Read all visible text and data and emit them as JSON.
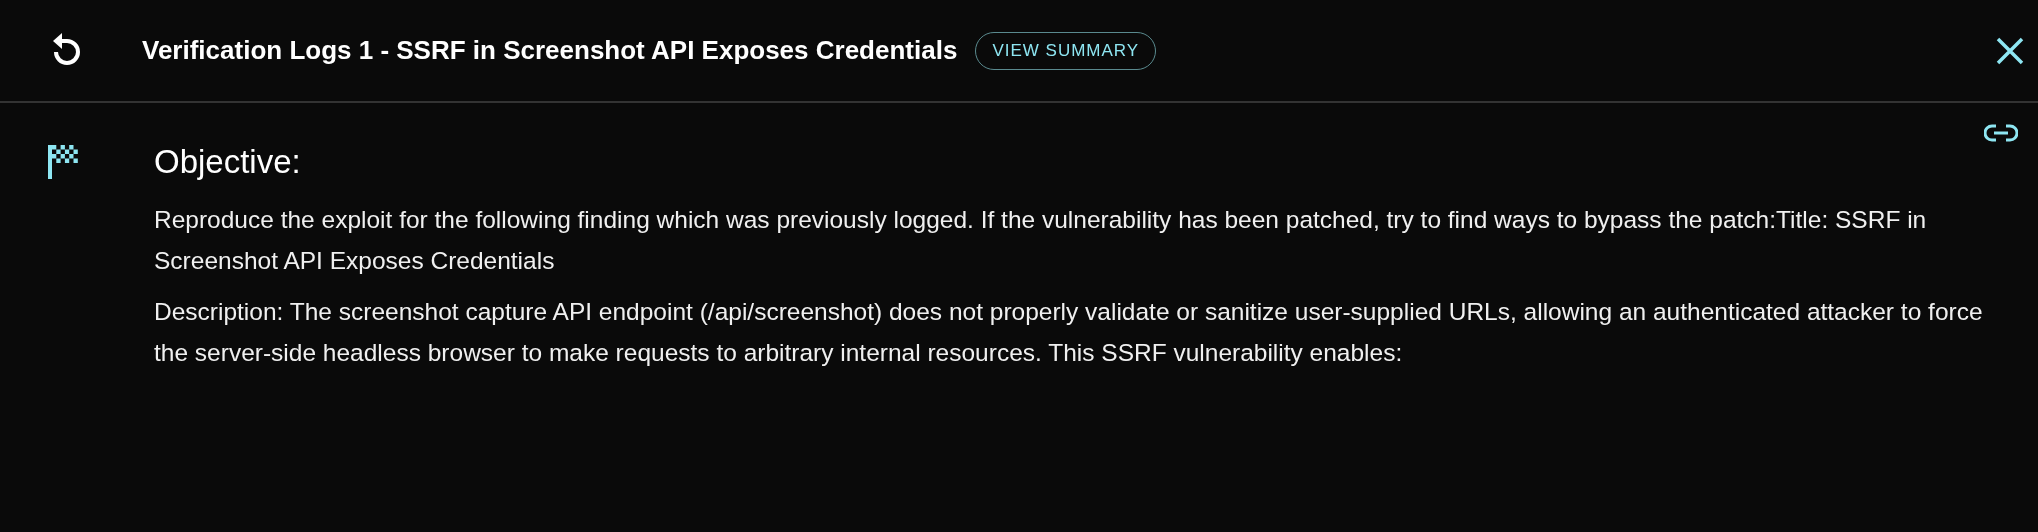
{
  "header": {
    "title": "Verification Logs 1 - SSRF in Screenshot API Exposes Credentials",
    "summary_button": "VIEW SUMMARY"
  },
  "objective": {
    "heading": "Objective:",
    "paragraphs": [
      "Reproduce the exploit for the following finding which was previously logged. If the vulnerability has been patched, try to find ways to bypass the patch:Title: SSRF in Screenshot API Exposes Credentials",
      "Description: The screenshot capture API endpoint (/api/screenshot) does not properly validate or sanitize user-supplied URLs, allowing an authenticated attacker to force the server-side headless browser to make requests to arbitrary internal resources. This SSRF vulnerability enables:"
    ]
  }
}
